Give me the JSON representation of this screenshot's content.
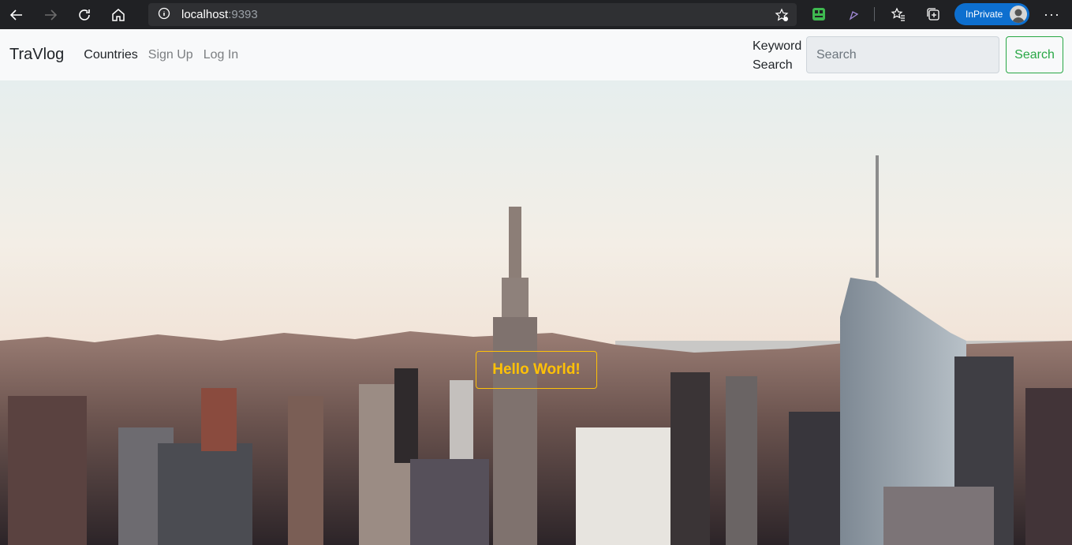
{
  "browser": {
    "url_host": "localhost",
    "url_port": ":9393",
    "profile_label": "InPrivate",
    "icons": [
      "back-icon",
      "forward-icon",
      "refresh-icon",
      "home-icon",
      "info-icon",
      "favorite-add-icon",
      "extension-icon",
      "pen-icon",
      "favorites-icon",
      "collections-icon",
      "avatar",
      "more-icon"
    ]
  },
  "navbar": {
    "brand": "TraVlog",
    "links": [
      {
        "label": "Countries"
      },
      {
        "label": "Sign Up"
      },
      {
        "label": "Log In"
      }
    ],
    "search_label": "Keyword Search",
    "search_placeholder": "Search",
    "search_button": "Search"
  },
  "hero": {
    "button_label": "Hello World!"
  },
  "colors": {
    "accent_green": "#28a745",
    "accent_yellow": "#ffc107",
    "browser_profile": "#0d6fcf"
  }
}
